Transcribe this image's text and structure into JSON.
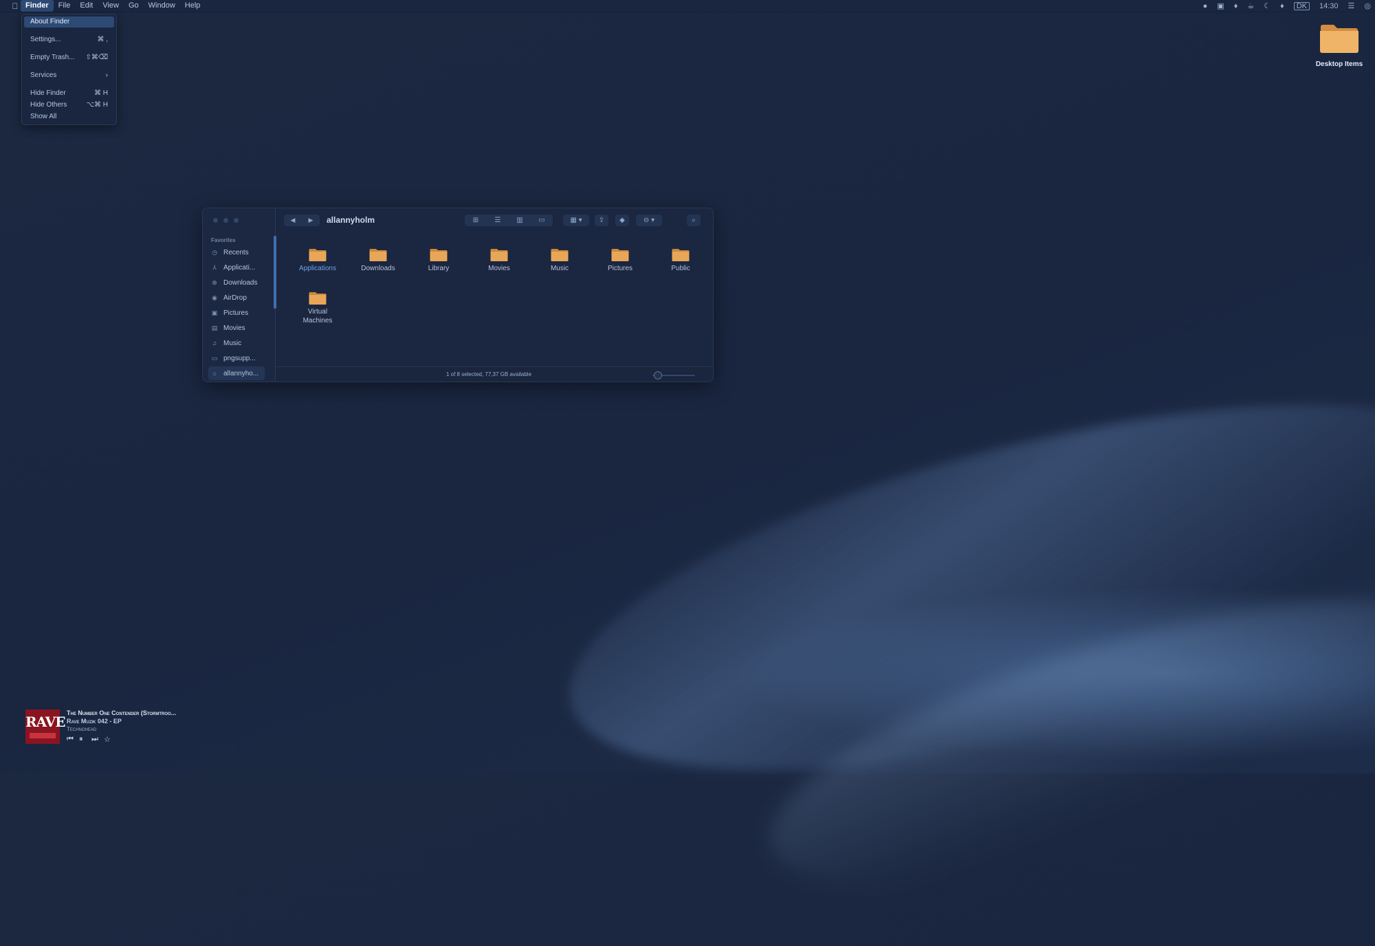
{
  "menubar": {
    "apple": "",
    "items": [
      "Finder",
      "File",
      "Edit",
      "View",
      "Go",
      "Window",
      "Help"
    ],
    "active": "Finder",
    "status_icons": [
      "record-dot-icon",
      "screen-icon",
      "drop-icon",
      "cup-icon",
      "moon-icon",
      "drop-icon",
      "input-source-icon",
      "control-center-icon",
      "siri-icon"
    ],
    "input_source": "DK",
    "clock": "14:30"
  },
  "finder_menu": {
    "items": [
      {
        "label": "About Finder",
        "shortcut": "",
        "highlighted": true
      },
      {
        "label": "Settings...",
        "shortcut": "⌘ ,"
      },
      {
        "label": "Empty Trash...",
        "shortcut": "⇧⌘⌫"
      },
      {
        "label": "Services",
        "shortcut": "›"
      },
      {
        "label": "Hide Finder",
        "shortcut": "⌘ H"
      },
      {
        "label": "Hide Others",
        "shortcut": "⌥⌘ H"
      },
      {
        "label": "Show All",
        "shortcut": ""
      }
    ]
  },
  "desktop": {
    "item_label": "Desktop Items"
  },
  "finder_window": {
    "title": "allannyholm",
    "sidebar_heading": "Favorites",
    "sidebar_items": [
      {
        "label": "Recents",
        "icon": "clock-icon"
      },
      {
        "label": "Applicati...",
        "icon": "applications-icon"
      },
      {
        "label": "Downloads",
        "icon": "download-icon"
      },
      {
        "label": "AirDrop",
        "icon": "airdrop-icon"
      },
      {
        "label": "Pictures",
        "icon": "photo-icon"
      },
      {
        "label": "Movies",
        "icon": "film-icon"
      },
      {
        "label": "Music",
        "icon": "music-note-icon"
      },
      {
        "label": "pngsupp...",
        "icon": "folder-icon"
      },
      {
        "label": "allannyho...",
        "icon": "home-icon",
        "selected": true
      }
    ],
    "folders": [
      {
        "label": "Applications",
        "selected": true
      },
      {
        "label": "Downloads"
      },
      {
        "label": "Library"
      },
      {
        "label": "Movies"
      },
      {
        "label": "Music"
      },
      {
        "label": "Pictures"
      },
      {
        "label": "Public"
      },
      {
        "label": "Virtual Machines"
      }
    ],
    "status": "1 of 8 selected, 77,37 GB available",
    "folder_color": "#e8a758",
    "accent": "#6fa5ea"
  },
  "now_playing": {
    "title": "The Number One Contender (Stormtroo...",
    "album": "Rave Muzik 042 - EP",
    "artist": "Technohead",
    "art_text": "RAVE"
  }
}
